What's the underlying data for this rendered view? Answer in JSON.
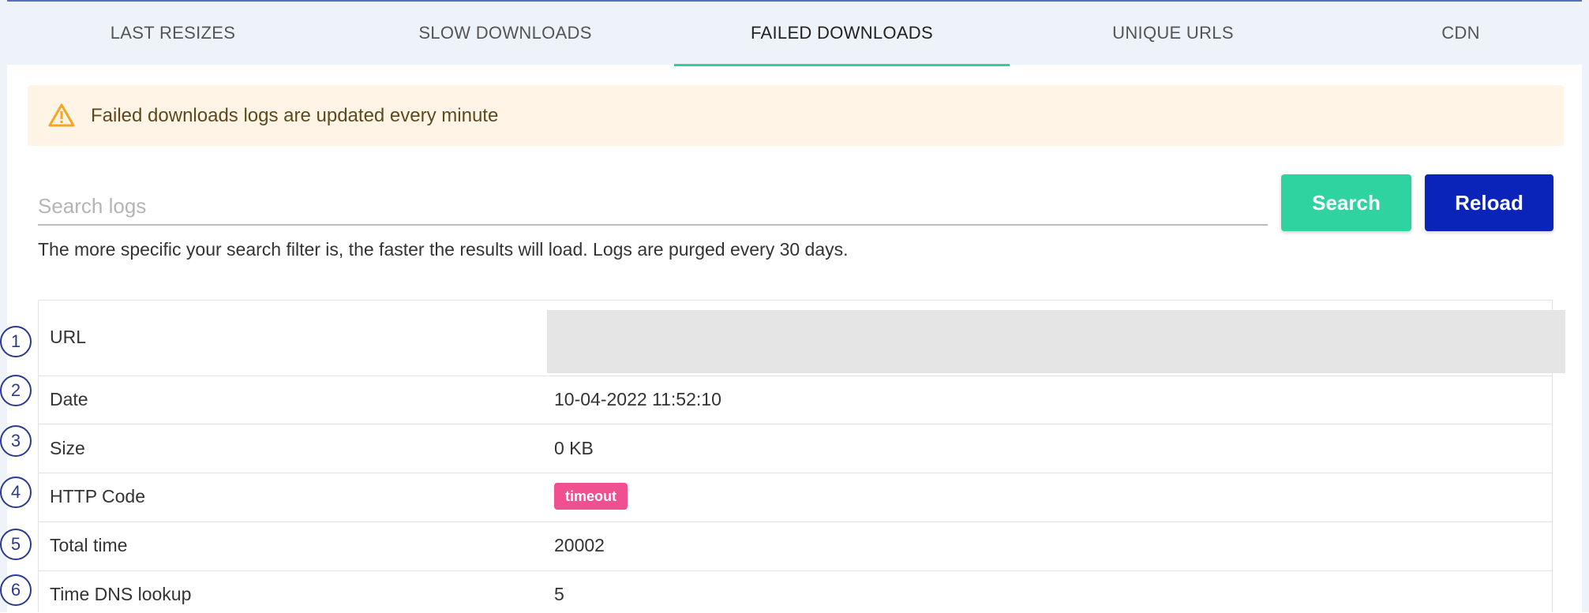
{
  "tabs": [
    {
      "label": "LAST RESIZES",
      "active": false
    },
    {
      "label": "SLOW DOWNLOADS",
      "active": false
    },
    {
      "label": "FAILED DOWNLOADS",
      "active": true
    },
    {
      "label": "UNIQUE URLS",
      "active": false
    },
    {
      "label": "CDN",
      "active": false
    }
  ],
  "alert": {
    "icon": "warning-icon",
    "text": "Failed downloads logs are updated every minute",
    "color": "#f5a623"
  },
  "search": {
    "placeholder": "Search logs",
    "value": "",
    "search_label": "Search",
    "reload_label": "Reload",
    "hint": "The more specific your search filter is, the faster the results will load. Logs are purged every 30 days."
  },
  "log": {
    "rows": [
      {
        "marker": "1",
        "label": "URL",
        "value": ""
      },
      {
        "marker": "2",
        "label": "Date",
        "value": "10-04-2022 11:52:10"
      },
      {
        "marker": "3",
        "label": "Size",
        "value": "0 KB"
      },
      {
        "marker": "4",
        "label": "HTTP Code",
        "value": "timeout"
      },
      {
        "marker": "5",
        "label": "Total time",
        "value": "20002"
      },
      {
        "marker": "6",
        "label": "Time DNS lookup",
        "value": "5"
      }
    ]
  },
  "colors": {
    "accent_green": "#2ed39f",
    "reload_blue": "#0a23b8",
    "badge_pink": "#f05090"
  }
}
